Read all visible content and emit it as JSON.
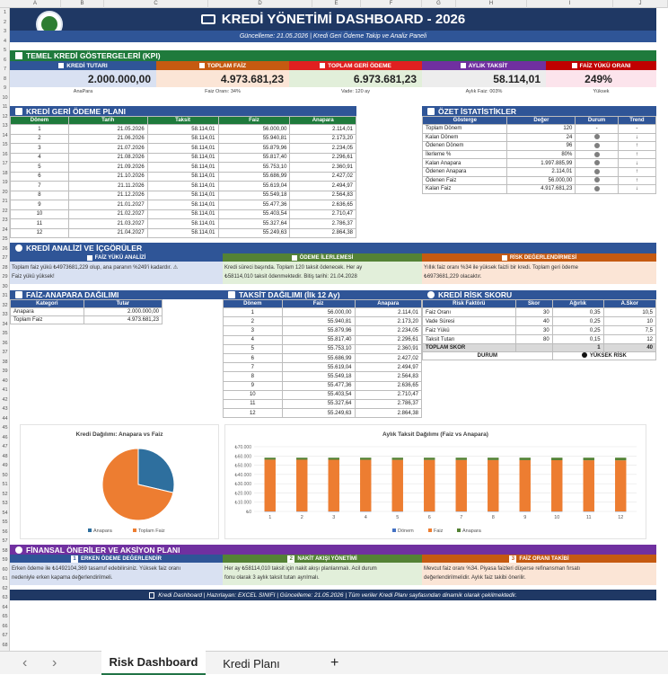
{
  "columns": [
    "A",
    "B",
    "C",
    "D",
    "E",
    "F",
    "G",
    "H",
    "I",
    "J"
  ],
  "rows": [
    "1",
    "2",
    "3",
    "4",
    "5",
    "6",
    "7",
    "8",
    "9",
    "10",
    "11",
    "12",
    "13",
    "14",
    "15",
    "16",
    "17",
    "18",
    "19",
    "20",
    "21",
    "22",
    "23",
    "24",
    "25",
    "26",
    "27",
    "28",
    "29",
    "30",
    "31",
    "32",
    "33",
    "34",
    "35",
    "36",
    "37",
    "38",
    "39",
    "40",
    "41",
    "42",
    "43",
    "44",
    "45",
    "46",
    "47",
    "48",
    "49",
    "50",
    "51",
    "52",
    "53",
    "54",
    "55",
    "56",
    "57",
    "58",
    "59",
    "60",
    "61",
    "62",
    "63",
    "64",
    "65",
    "66",
    "67",
    "68"
  ],
  "header": {
    "title": "KREDİ YÖNETİMİ DASHBOARD - 2026",
    "subtitle": "Güncelleme: 21.05.2026 | Kredi Geri Ödeme Takip ve Analiz Paneli"
  },
  "kpi": {
    "title": "TEMEL KREDİ GÖSTERGELERİ (KPI)",
    "cards": [
      {
        "label": "KREDİ TUTARI",
        "value": "2.000.000,00",
        "sub": "AnaPara",
        "color": "#2f5597",
        "bg": "#d9e1f2"
      },
      {
        "label": "TOPLAM FAİZ",
        "value": "4.973.681,23",
        "sub": "Faiz Oranı: 34%",
        "color": "#c55a11",
        "bg": "#fbe5d6"
      },
      {
        "label": "TOPLAM GERİ ÖDEME",
        "value": "6.973.681,23",
        "sub": "Vade: 120 ay",
        "color": "#e02020",
        "bg": "#e2efda"
      },
      {
        "label": "AYLIK TAKSİT",
        "value": "58.114,01",
        "sub": "Aylık Faiz: 003%",
        "color": "#7030a0",
        "bg": "#ededed"
      },
      {
        "label": "FAİZ YÜKÜ ORANI",
        "value": "249%",
        "sub": "Yüksek",
        "color": "#c00000",
        "bg": "#fce4ec"
      }
    ]
  },
  "plan": {
    "title": "KREDİ GERİ ÖDEME PLANI",
    "headers": [
      "Dönem",
      "Tarih",
      "Taksit",
      "Faiz",
      "Anapara"
    ],
    "rows": [
      [
        "1",
        "21.05.2026",
        "58.114,01",
        "56.000,00",
        "2.114,01"
      ],
      [
        "2",
        "21.06.2026",
        "58.114,01",
        "55.940,81",
        "2.173,20"
      ],
      [
        "3",
        "21.07.2026",
        "58.114,01",
        "55.879,96",
        "2.234,05"
      ],
      [
        "4",
        "21.08.2026",
        "58.114,01",
        "55.817,40",
        "2.296,61"
      ],
      [
        "5",
        "21.09.2026",
        "58.114,01",
        "55.753,10",
        "2.360,91"
      ],
      [
        "6",
        "21.10.2026",
        "58.114,01",
        "55.686,99",
        "2.427,02"
      ],
      [
        "7",
        "21.11.2026",
        "58.114,01",
        "55.619,04",
        "2.494,97"
      ],
      [
        "8",
        "21.12.2026",
        "58.114,01",
        "55.549,18",
        "2.564,83"
      ],
      [
        "9",
        "21.01.2027",
        "58.114,01",
        "55.477,36",
        "2.636,65"
      ],
      [
        "10",
        "21.02.2027",
        "58.114,01",
        "55.403,54",
        "2.710,47"
      ],
      [
        "11",
        "21.03.2027",
        "58.114,01",
        "55.327,64",
        "2.786,37"
      ],
      [
        "12",
        "21.04.2027",
        "58.114,01",
        "55.249,63",
        "2.864,38"
      ]
    ]
  },
  "summary": {
    "title": "ÖZET İSTATİSTİKLER",
    "headers": [
      "Gösterge",
      "Değer",
      "Durum",
      "Trend"
    ],
    "rows": [
      [
        "Toplam Dönem",
        "120",
        "-",
        "-"
      ],
      [
        "Kalan Dönem",
        "24",
        "dot",
        "↓"
      ],
      [
        "Ödenen Dönem",
        "96",
        "dot",
        "↑"
      ],
      [
        "İlerleme %",
        "80%",
        "dot",
        "↑"
      ],
      [
        "Kalan Anapara",
        "1.997.885,99",
        "dot",
        "↓"
      ],
      [
        "Ödenen Anapara",
        "2.114,01",
        "dot",
        "↑"
      ],
      [
        "Ödenen Faiz",
        "56.000,00",
        "dot",
        "↑"
      ],
      [
        "Kalan Faiz",
        "4.917.681,23",
        "dot",
        "↓"
      ]
    ]
  },
  "analysis": {
    "title": "KREDİ ANALİZİ VE İÇGÖRÜLER",
    "cols": [
      {
        "head": "FAİZ YÜKÜ ANALİZİ",
        "text1": "Toplam faiz yükü ₺4973681,229 olup, ana paranın %249'i kadardır. ⚠",
        "text2": "Faiz yükü yüksek!",
        "bg": "#d9e1f2",
        "hc": "#2f5597"
      },
      {
        "head": "ÖDEME İLERLEMESİ",
        "text1": "Kredi süreci başında. Toplam 120 taksit ödenecek. Her ay",
        "text2": "₺58114,010 taksit ödenmektedir. Bitiş tarihi: 21.04.2028",
        "bg": "#e2efda",
        "hc": "#548235"
      },
      {
        "head": "RİSK DEĞERLENDİRMESİ",
        "text1": "Yıllık faiz oranı %34 ile yüksek faizli bir kredi. Toplam geri ödeme",
        "text2": "₺6973681,229 olacaktır.",
        "bg": "#fbe5d6",
        "hc": "#c55a11"
      }
    ]
  },
  "distribution": {
    "title": "FAİZ-ANAPARA DAĞILIMI",
    "headers": [
      "Kategori",
      "Tutar"
    ],
    "rows": [
      [
        "Anapara",
        "2.000.000,00"
      ],
      [
        "Toplam Faiz",
        "4.973.681,23"
      ]
    ]
  },
  "installments": {
    "title": "TAKSİT DAĞILIMI (İlk 12 Ay)",
    "headers": [
      "Dönem",
      "Faiz",
      "Anapara"
    ]
  },
  "risk": {
    "title": "KREDİ RİSK SKORU",
    "headers": [
      "Risk Faktörü",
      "Skor",
      "Ağırlık",
      "A.Skor"
    ],
    "rows": [
      [
        "Faiz Oranı",
        "30",
        "0,35",
        "10,5"
      ],
      [
        "Vade Süresi",
        "40",
        "0,25",
        "10"
      ],
      [
        "Faiz Yükü",
        "30",
        "0,25",
        "7,5"
      ],
      [
        "Taksit Tutarı",
        "80",
        "0,15",
        "12"
      ]
    ],
    "total_label": "TOPLAM SKOR",
    "total_weight": "1",
    "total_value": "40",
    "status_label": "DURUM",
    "status_value": "YÜKSEK RİSK"
  },
  "chart_data": [
    {
      "type": "pie",
      "title": "Kredi Dağılımı: Anapara vs Faiz",
      "categories": [
        "Anapara",
        "Toplam Faiz"
      ],
      "values": [
        2000000,
        4973681.23
      ],
      "colors": [
        "#2e6f9e",
        "#ed7d31"
      ],
      "legend": "bottom"
    },
    {
      "type": "bar",
      "stacked": true,
      "title": "Aylık Taksit Dağılımı (Faiz vs Anapara)",
      "x": [
        "1",
        "2",
        "3",
        "4",
        "5",
        "6",
        "7",
        "8",
        "9",
        "10",
        "11",
        "12"
      ],
      "series": [
        {
          "name": "Dönem",
          "values": [
            1,
            2,
            3,
            4,
            5,
            6,
            7,
            8,
            9,
            10,
            11,
            12
          ],
          "color": "#4472c4"
        },
        {
          "name": "Faiz",
          "values": [
            56000,
            55940.81,
            55879.96,
            55817.4,
            55753.1,
            55686.99,
            55619.04,
            55549.18,
            55477.36,
            55403.54,
            55327.64,
            55249.63
          ],
          "color": "#ed7d31"
        },
        {
          "name": "Anapara",
          "values": [
            2114.01,
            2173.2,
            2234.05,
            2296.61,
            2360.91,
            2427.02,
            2494.97,
            2564.83,
            2636.65,
            2710.47,
            2786.37,
            2864.38
          ],
          "color": "#548235"
        }
      ],
      "yticks": [
        "₺70.000",
        "₺60.000",
        "₺50.000",
        "₺40.000",
        "₺30.000",
        "₺20.000",
        "₺10.000",
        "₺0"
      ],
      "ylim": [
        0,
        70000
      ],
      "legend": "bottom"
    }
  ],
  "recommendations": {
    "title": "FİNANSAL ÖNERİLER VE AKSİYON PLANI",
    "cols": [
      {
        "head": "ERKEN ÖDEME DEĞERLENDİR",
        "num": "1",
        "text1": "Erken ödeme ile ₺1492104,369 tasarruf edebilirsiniz. Yüksek faiz oranı",
        "text2": "nedeniyle erken kapama değerlendirilmeli.",
        "bg": "#d9e1f2",
        "hc": "#2f5597"
      },
      {
        "head": "NAKİT AKIŞI YÖNETİMİ",
        "num": "2",
        "text1": "Her ay ₺58114,010 taksit için nakit akışı planlanmalı. Acil durum",
        "text2": "fonu olarak 3 aylık taksit tutarı ayrılmalı.",
        "bg": "#e2efda",
        "hc": "#548235"
      },
      {
        "head": "FAİZ ORANI TAKİBİ",
        "num": "3",
        "text1": "Mevcut faiz oranı %34. Piyasa faizleri düşerse refinansman fırsatı",
        "text2": "değerlendirilmelidir. Aylık faiz takibi önerilir.",
        "bg": "#fbe5d6",
        "hc": "#c55a11"
      }
    ]
  },
  "footer": "Kredi Dashboard | Hazırlayan: EXCEL SINIFI | Güncelleme: 21.05.2026 | Tüm veriler Kredi Planı sayfasından dinamik olarak çekilmektedir.",
  "tabs": {
    "active": "Risk Dashboard",
    "other": "Kredi Planı",
    "add": "+",
    "prev": "‹",
    "next": "›"
  }
}
